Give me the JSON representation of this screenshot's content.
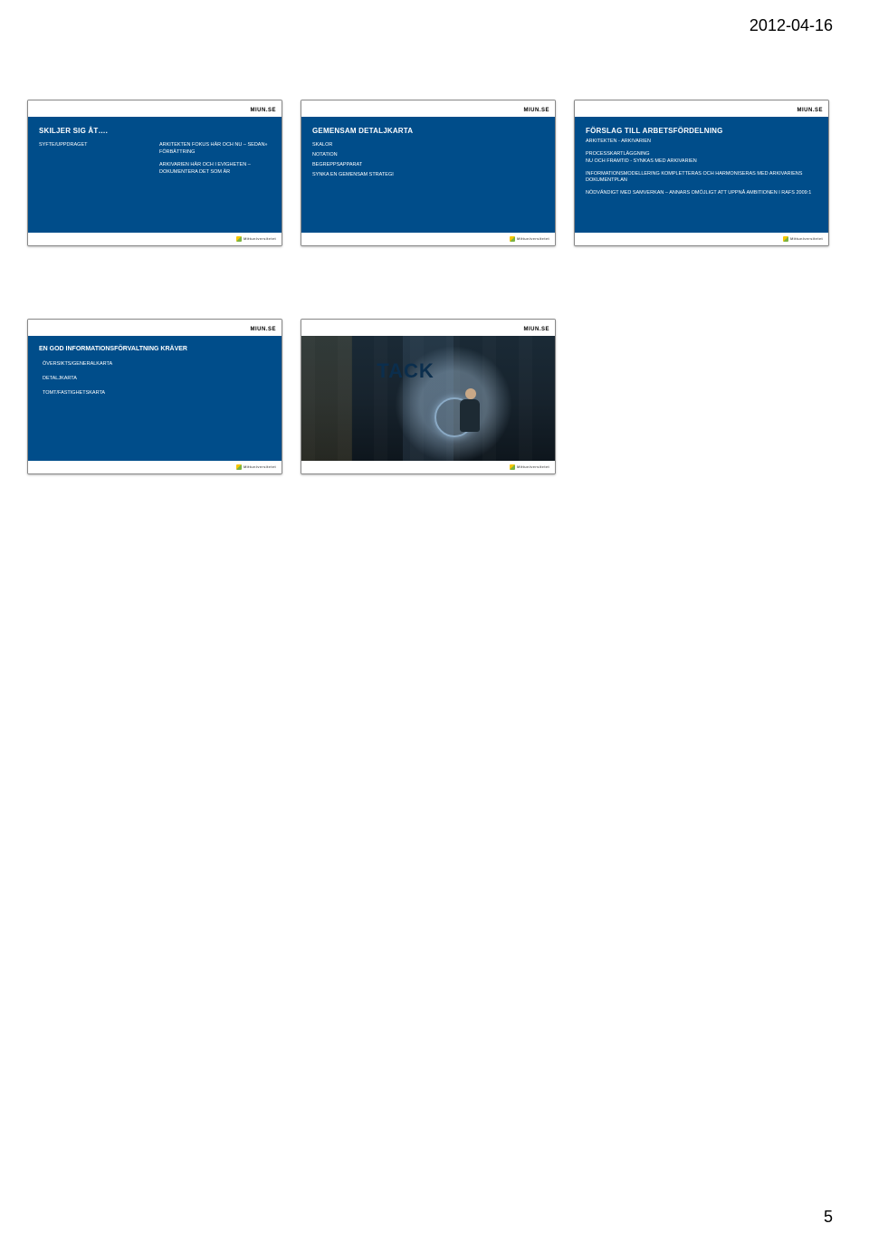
{
  "meta": {
    "date": "2012-04-16",
    "page_number": "5",
    "brand": "MIUN.SE",
    "brand_sub": "Mittuniversitetet",
    "footer_mark": "Mittuniversitetet"
  },
  "slides": {
    "s1": {
      "title": "SKILJER SIG ÅT….",
      "left_label": "SYFTE/UPPDRAGET",
      "right_lines": [
        "ARKITEKTEN FOKUS HÄR OCH NU – SEDAN» FÖRBÄTTRING",
        "ARKIVARIEN HÄR OCH I EVIGHETEN – DOKUMENTERA DET SOM ÄR"
      ]
    },
    "s2": {
      "title": "GEMENSAM DETALJKARTA",
      "items": [
        "SKALOR",
        "NOTATION",
        "BEGREPPSAPPARAT",
        "SYNKA EN GEMENSAM STRATEGI"
      ]
    },
    "s3": {
      "title": "FÖRSLAG TILL ARBETSFÖRDELNING",
      "sub": "ARKITEKTEN - ARKIVARIEN",
      "blocks": [
        "PROCESSKARTLÄGGNING\nNU OCH FRAMTID - SYNKAS MED ARKIVARIEN",
        "INFORMATIONSMODELLERING KOMPLETTERAS OCH HARMONISERAS MED ARKIVARIENS DOKUMENTPLAN",
        "NÖDVÄNDIGT MED SAMVERKAN – ANNARS OMÖJLIGT ATT UPPNÅ AMBITIONEN I RAFS 2009:1"
      ]
    },
    "s4": {
      "title": "EN GOD INFORMATIONSFÖRVALTNING KRÄVER",
      "items": [
        "ÖVERSIKTS/GENERALKARTA",
        "DETALJKARTA",
        "TOMT/FASTIGHETSKARTA"
      ]
    },
    "s5": {
      "text": "TACK"
    }
  }
}
